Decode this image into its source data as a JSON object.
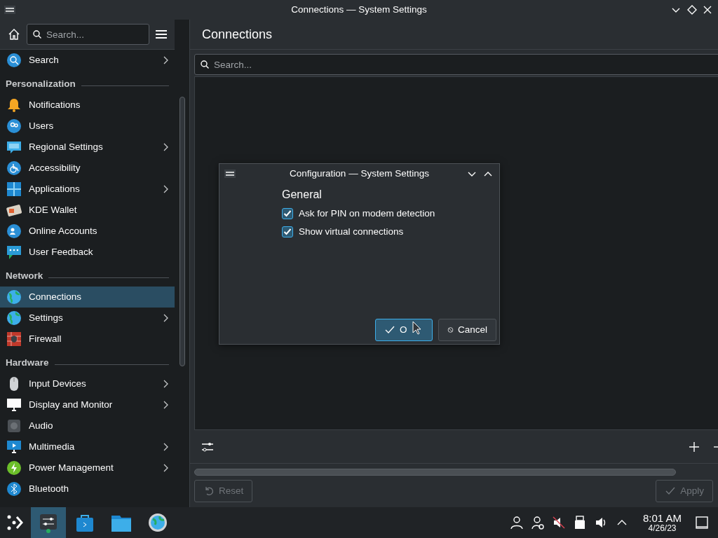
{
  "window": {
    "title": "Connections — System Settings"
  },
  "sidebar": {
    "search": {
      "placeholder": "Search..."
    },
    "sections": [
      {
        "items": [
          {
            "label": "Search",
            "submenu": true,
            "selected": false
          }
        ]
      },
      {
        "heading": "Personalization",
        "items": [
          {
            "label": "Notifications",
            "submenu": false,
            "selected": false
          },
          {
            "label": "Users",
            "submenu": false,
            "selected": false
          },
          {
            "label": "Regional Settings",
            "submenu": true,
            "selected": false
          },
          {
            "label": "Accessibility",
            "submenu": false,
            "selected": false
          },
          {
            "label": "Applications",
            "submenu": true,
            "selected": false
          },
          {
            "label": "KDE Wallet",
            "submenu": false,
            "selected": false
          },
          {
            "label": "Online Accounts",
            "submenu": false,
            "selected": false
          },
          {
            "label": "User Feedback",
            "submenu": false,
            "selected": false
          }
        ]
      },
      {
        "heading": "Network",
        "items": [
          {
            "label": "Connections",
            "submenu": false,
            "selected": true
          },
          {
            "label": "Settings",
            "submenu": true,
            "selected": false
          },
          {
            "label": "Firewall",
            "submenu": false,
            "selected": false
          }
        ]
      },
      {
        "heading": "Hardware",
        "items": [
          {
            "label": "Input Devices",
            "submenu": true,
            "selected": false
          },
          {
            "label": "Display and Monitor",
            "submenu": true,
            "selected": false
          },
          {
            "label": "Audio",
            "submenu": false,
            "selected": false
          },
          {
            "label": "Multimedia",
            "submenu": true,
            "selected": false
          },
          {
            "label": "Power Management",
            "submenu": true,
            "selected": false
          },
          {
            "label": "Bluetooth",
            "submenu": false,
            "selected": false
          }
        ]
      }
    ]
  },
  "page": {
    "title": "Connections",
    "search": {
      "placeholder": "Search..."
    },
    "buttons": [
      {
        "label": "Reset",
        "disabled": true
      },
      {
        "label": "Apply",
        "disabled": true
      }
    ]
  },
  "dialog": {
    "title": "Configuration — System Settings",
    "heading": "General",
    "options": [
      {
        "label": "Ask for PIN on modem detection",
        "checked": true
      },
      {
        "label": "Show virtual connections",
        "checked": true
      }
    ],
    "buttons": [
      {
        "label": "O",
        "highlighted": true
      },
      {
        "label": "Cancel",
        "highlighted": false
      }
    ]
  },
  "taskbar": {
    "tasks": [
      {
        "selected": true
      },
      {
        "selected": false
      },
      {
        "selected": false
      },
      {
        "selected": false
      }
    ],
    "clock": {
      "time": "8:01 AM",
      "date": "4/26/23"
    }
  }
}
